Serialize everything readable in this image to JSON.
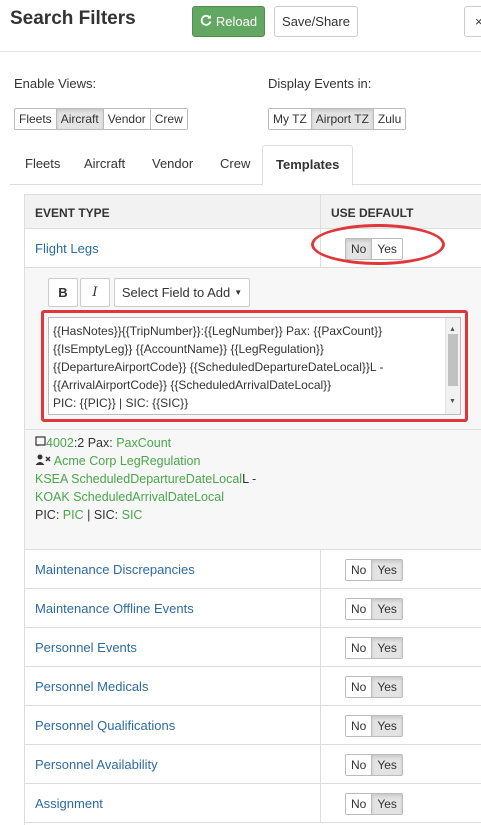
{
  "header": {
    "title": "Search Filters",
    "reload_label": "Reload",
    "save_label": "Save/Share",
    "close_label": "×"
  },
  "enable_views": {
    "label": "Enable Views:",
    "options": [
      "Fleets",
      "Aircraft",
      "Vendor",
      "Crew"
    ],
    "selected": "Aircraft"
  },
  "display_events": {
    "label": "Display Events in:",
    "options": [
      "My TZ",
      "Airport TZ",
      "Zulu"
    ],
    "selected": "Airport TZ"
  },
  "tabs": {
    "items": [
      "Fleets",
      "Aircraft",
      "Vendor",
      "Crew",
      "Templates"
    ],
    "active": "Templates"
  },
  "table": {
    "col_event_type": "EVENT TYPE",
    "col_use_default": "USE DEFAULT",
    "no_label": "No",
    "yes_label": "Yes",
    "flight_legs": {
      "name": "Flight Legs",
      "use_default": "No"
    },
    "editor": {
      "bold_label": "B",
      "italic_label": "I",
      "select_field_label": "Select Field to Add",
      "template_lines": [
        "{{HasNotes}}{{TripNumber}}:{{LegNumber}} Pax: {{PaxCount}}",
        "{{IsEmptyLeg}} {{AccountName}} {{LegRegulation}}",
        "{{DepartureAirportCode}} {{ScheduledDepartureDateLocal}}L -",
        "{{ArrivalAirportCode}} {{ScheduledArrivalDateLocal}}",
        "PIC: {{PIC}} | SIC: {{SIC}}"
      ]
    },
    "preview": {
      "line1_trip": "4002",
      "line1_leg": ":2",
      "line1_pax": " Pax: ",
      "line1_paxcount": "PaxCount",
      "line2_account": "Acme Corp",
      "line2_reg": "LegRegulation",
      "line3_dep": "KSEA ScheduledDepartureDateLocal",
      "line3_suffix": "L -",
      "line4_arr": "KOAK ScheduledArrivalDateLocal",
      "line5_pic_label": "PIC: ",
      "line5_pic": "PIC",
      "line5_sep": " | SIC: ",
      "line5_sic": "SIC"
    },
    "rows": [
      {
        "name": "Maintenance Discrepancies",
        "use_default": "Yes"
      },
      {
        "name": "Maintenance Offline Events",
        "use_default": "Yes"
      },
      {
        "name": "Personnel Events",
        "use_default": "Yes"
      },
      {
        "name": "Personnel Medicals",
        "use_default": "Yes"
      },
      {
        "name": "Personnel Qualifications",
        "use_default": "Yes"
      },
      {
        "name": "Personnel Availability",
        "use_default": "Yes"
      },
      {
        "name": "Assignment",
        "use_default": "Yes"
      }
    ]
  },
  "colors": {
    "accent_green": "#62a762",
    "link_blue": "#2c6aa0",
    "highlight_red": "#e0383a",
    "field_green": "#4aa64a"
  }
}
